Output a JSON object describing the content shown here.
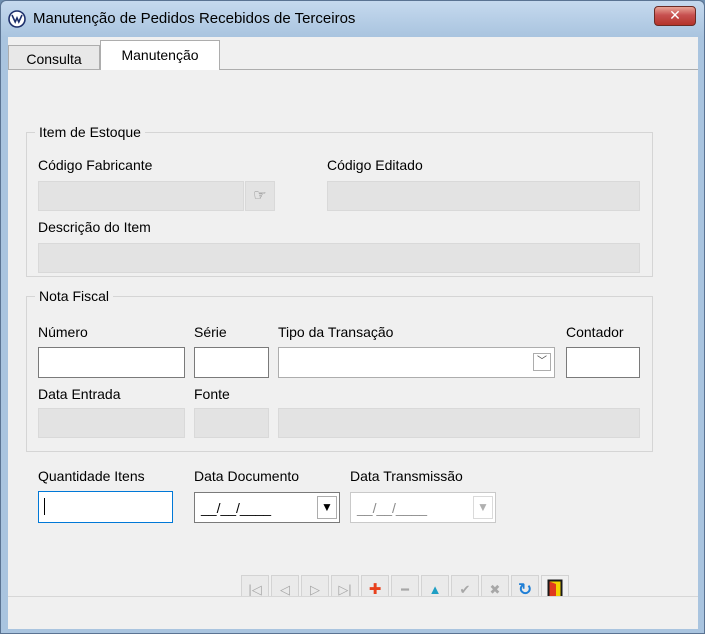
{
  "window": {
    "title": "Manutenção de Pedidos Recebidos de Terceiros",
    "close_label": "✕"
  },
  "tabs": [
    {
      "label": "Consulta"
    },
    {
      "label": "Manutenção"
    }
  ],
  "item_estoque": {
    "title": "Item de Estoque",
    "codigo_fabricante_label": "Código Fabricante",
    "codigo_editado_label": "Código Editado",
    "descricao_label": "Descrição do Item",
    "lookup_icon": "☞"
  },
  "nota_fiscal": {
    "title": "Nota Fiscal",
    "numero_label": "Número",
    "serie_label": "Série",
    "tipo_label": "Tipo da Transação",
    "contador_label": "Contador",
    "data_entrada_label": "Data Entrada",
    "fonte_label": "Fonte",
    "dropdown_icon": "﹀"
  },
  "bottom": {
    "quantidade_label": "Quantidade Itens",
    "data_documento_label": "Data Documento",
    "data_documento_value": "__/__/____",
    "data_transmissao_label": "Data Transmissão",
    "data_transmissao_value": "__/__/____",
    "dropdown_icon": "▼"
  },
  "toolbar": {
    "first": "|◁",
    "prev": "◁",
    "next": "▷",
    "last": "▷|",
    "add": "✚",
    "remove": "━",
    "edit": "▲",
    "confirm": "✔",
    "cancel": "✖",
    "refresh": "↻"
  },
  "colors": {
    "add": "#e8401c",
    "edit": "#1f9fc4",
    "refresh": "#1f7fd6",
    "exit_door": "#f4d200"
  }
}
